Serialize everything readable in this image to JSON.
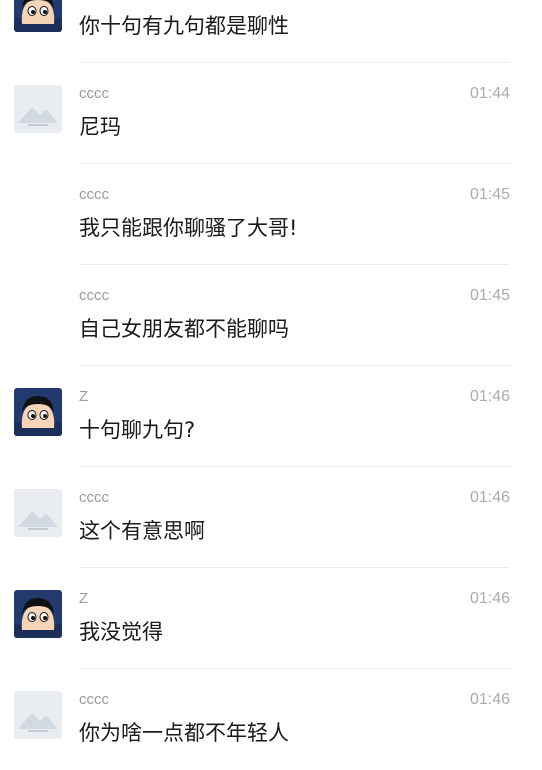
{
  "messages": [
    {
      "sender": "",
      "time": "",
      "text": "你十句有九句都是聊性",
      "avatar": "cartoon-boy-avatar"
    },
    {
      "sender": "cccc",
      "time": "01:44",
      "text": "尼玛",
      "avatar": "landscape-placeholder-avatar"
    },
    {
      "sender": "cccc",
      "time": "01:45",
      "text": "我只能跟你聊骚了大哥!",
      "avatar": "none"
    },
    {
      "sender": "cccc",
      "time": "01:45",
      "text": "自己女朋友都不能聊吗",
      "avatar": "none"
    },
    {
      "sender": "Z",
      "time": "01:46",
      "text": "十句聊九句?",
      "avatar": "cartoon-boy-avatar"
    },
    {
      "sender": "cccc",
      "time": "01:46",
      "text": "这个有意思啊",
      "avatar": "landscape-placeholder-avatar"
    },
    {
      "sender": "Z",
      "time": "01:46",
      "text": "我没觉得",
      "avatar": "cartoon-boy-avatar"
    },
    {
      "sender": "cccc",
      "time": "01:46",
      "text": "你为啥一点都不年轻人",
      "avatar": "landscape-placeholder-avatar"
    }
  ],
  "colors": {
    "text": "#1a1a1a",
    "meta": "#9b9b9b",
    "divider": "#ececec",
    "cartoon_avatar_bg": "#223a6e",
    "placeholder_avatar_bg": "#e9edf1"
  }
}
